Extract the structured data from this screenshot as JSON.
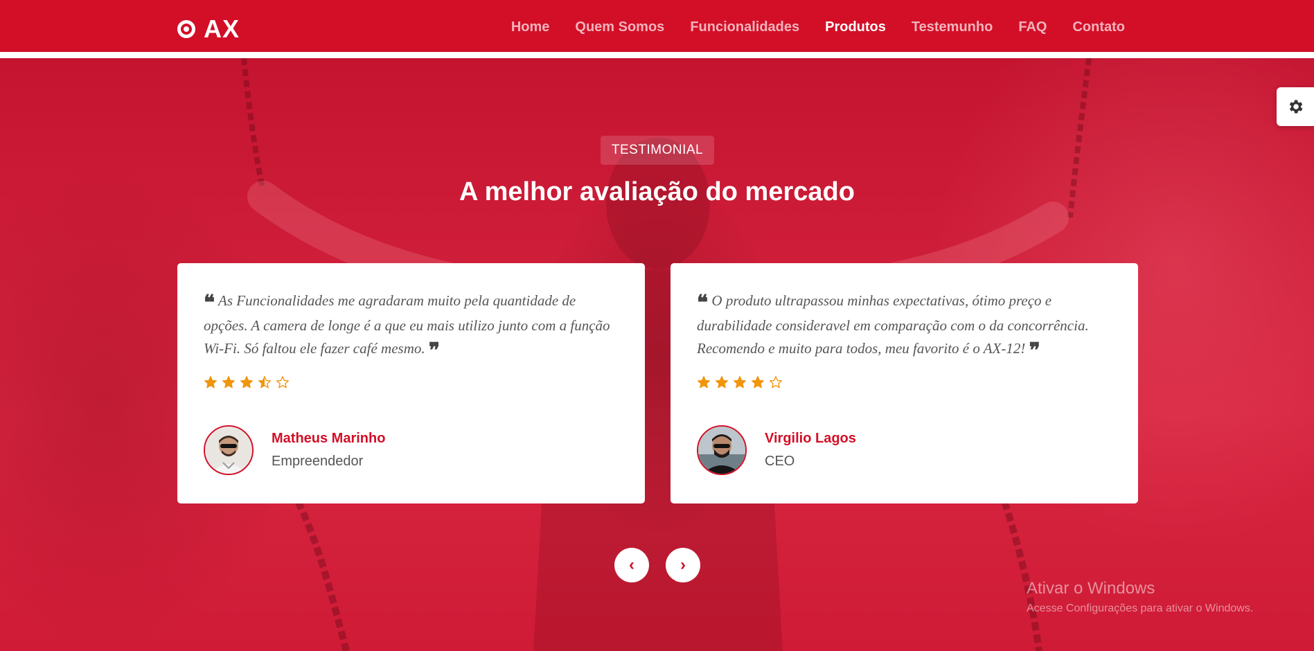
{
  "brand": {
    "name": "AX"
  },
  "nav": {
    "items": [
      {
        "label": "Home"
      },
      {
        "label": "Quem Somos"
      },
      {
        "label": "Funcionalidades"
      },
      {
        "label": "Produtos",
        "active": true
      },
      {
        "label": "Testemunho"
      },
      {
        "label": "FAQ"
      },
      {
        "label": "Contato"
      }
    ]
  },
  "section": {
    "badge": "TESTIMONIAL",
    "title": "A melhor avaliação do mercado"
  },
  "testimonials": [
    {
      "quote": "As Funcionalidades me agradaram muito pela quantidade de opções. A camera de longe é a que eu mais utilizo junto com a função Wi-Fi. Só faltou ele fazer café mesmo.",
      "rating": 3.5,
      "name": "Matheus Marinho",
      "role": "Empreendedor"
    },
    {
      "quote": "O produto ultrapassou minhas expectativas, ótimo preço e durabilidade consideravel em comparação com o da concorrência. Recomendo e muito para todos, meu favorito é o AX-12!",
      "rating": 4,
      "name": "Virgilio Lagos",
      "role": "CEO"
    }
  ],
  "carousel": {
    "prev_label": "‹",
    "next_label": "›"
  },
  "watermark": {
    "title": "Ativar o Windows",
    "subtitle": "Acesse Configurações para ativar o Windows."
  },
  "colors": {
    "primary": "#d20f27",
    "star": "#f0950c",
    "white": "#ffffff"
  },
  "icons": {
    "settings": "gear-icon",
    "quote_open": "quote-left-icon",
    "quote_close": "quote-right-icon",
    "star": "star-icon"
  }
}
